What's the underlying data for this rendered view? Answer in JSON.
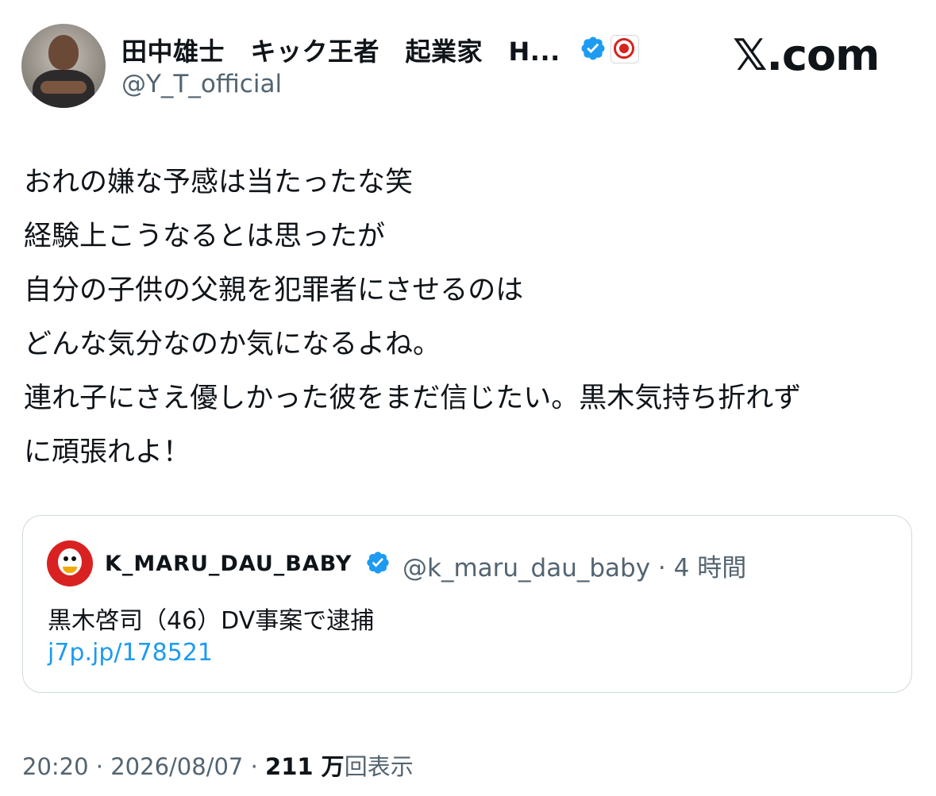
{
  "colors": {
    "text": "#0f1419",
    "secondary_text": "#536471",
    "link": "#1d9bf0",
    "verified_badge": "#1d9bf0",
    "quote_border": "#cfd9de"
  },
  "author": {
    "display_name": "田中雄士　キック王者　起業家　H...",
    "handle": "@Y_T_official",
    "avatar": "author-avatar",
    "verified_icon": "verified-badge-icon",
    "affiliation_icon": "affiliation-logo-icon"
  },
  "brand": {
    "label": "𝕏.com"
  },
  "tweet": {
    "lines": [
      "おれの嫌な予感は当たったな笑",
      "経験上こうなるとは思ったが",
      "自分の子供の父親を犯罪者にさせるのは",
      "どんな気分なのか気になるよね。",
      "連れ子にさえ優しかった彼をまだ信じたい。黒木気持ち折れず",
      "に頑張れよ！"
    ]
  },
  "quote": {
    "display_name": "K_MARU_DAU_BABY",
    "handle": "@k_maru_dau_baby",
    "separator": "·",
    "time": "4 時間",
    "text": "黒木啓司（46）DV事案で逮捕",
    "link": "j7p.jp/178521",
    "verified_icon": "verified-badge-icon"
  },
  "footer": {
    "time": "20:20",
    "separator1": "·",
    "date": "2026/08/07",
    "separator2": "·",
    "views_count": "211 万",
    "views_label": "回表示"
  }
}
